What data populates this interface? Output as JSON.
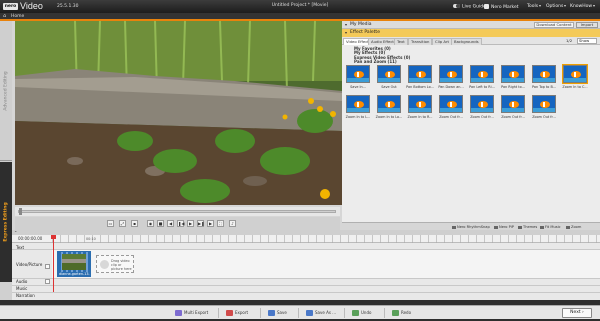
{
  "titlebar": {
    "logo": "nero",
    "app_name": "Video",
    "version": "25.5.1.30",
    "window_title": "Untitled Project * [Movie]",
    "live_guide": "Live Guide",
    "nero_market": "Nero Market",
    "tools": "Tools",
    "options": "Options",
    "knowhow": "KnowHow"
  },
  "homebar": {
    "label": "Home"
  },
  "sidetabs": {
    "advanced": "Advanced Editing",
    "express": "Express Editing"
  },
  "preview": {
    "icons": [
      "layout-icon",
      "fit-icon",
      "snapshot-icon",
      "stop-icon",
      "prev-frame-icon",
      "play-icon",
      "next-frame-icon",
      "fullscreen-icon",
      "volume-icon"
    ]
  },
  "rightpanel": {
    "my_media": "My Media",
    "download_label": "Download Content",
    "import_label": "Import",
    "effect_palette": "Effect Palette",
    "tabs": [
      "Video Effect",
      "Audio Effect",
      "Text",
      "Transition",
      "Clip Art",
      "Backgrounds"
    ],
    "count": "1/2",
    "show_label": "Show",
    "categories": [
      "My Favorites (0)",
      "My Effects (0)",
      "Express Video Effects (0)",
      "Pan and Zoom (11)"
    ],
    "effects": [
      "Save In...",
      "Save Out",
      "Pan Bottom Lo...",
      "Pan Down an...",
      "Pan Left to Ri...",
      "Pan Right to...",
      "Pan Top to B...",
      "Zoom In to C...",
      "Zoom In to L...",
      "Zoom In to Lo...",
      "Zoom In to R...",
      "Zoom Out fr...",
      "Zoom Out fr...",
      "Zoom Out fr...",
      "Zoom Out fr..."
    ],
    "bottom": [
      "Nero RhythmSnap",
      "Nero PiP",
      "Themes",
      "Fit Music",
      "Zoom"
    ]
  },
  "timeline": {
    "time": "00:00:00.00",
    "ruler_mark": "00:10",
    "tracks": [
      "Text",
      "Video/Picture",
      "Audio",
      "Music",
      "Narration"
    ],
    "clip_name": "dianne-garten-13...",
    "drop_text": "Drag video clip or picture here"
  },
  "actionbar": {
    "multi_export": "Multi Export",
    "export": "Export",
    "save": "Save",
    "save_as": "Save As ...",
    "undo": "Undo",
    "redo": "Redo",
    "next": "Next"
  },
  "colors": {
    "accent": "#e8820c",
    "palette_header": "#f4ca59",
    "clip": "#2a6db0"
  }
}
